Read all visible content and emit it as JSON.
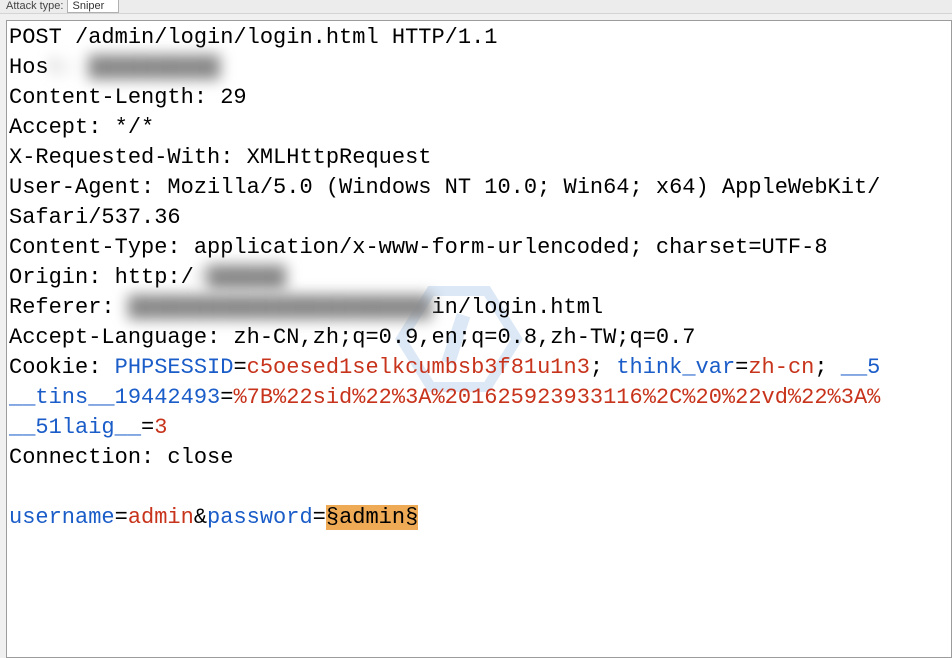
{
  "toolbar": {
    "label": "Attack type:",
    "selected": "Sniper"
  },
  "req": {
    "method_line": "POST /admin/login/login.html HTTP/1.1",
    "host_prefix": "Hos",
    "host_redacted": "t: ██████████",
    "content_length": "Content-Length: 29",
    "accept": "Accept: */*",
    "x_req_with": "X-Requested-With: XMLHttpRequest",
    "user_agent": "User-Agent: Mozilla/5.0 (Windows NT 10.0; Win64; x64) AppleWebKit/",
    "safari": "Safari/537.36",
    "content_type": "Content-Type: application/x-www-form-urlencoded; charset=UTF-8",
    "origin_prefix": "Origin: http:/",
    "origin_redacted": "/██████",
    "referer_prefix": "Referer:",
    "referer_redacted": " ███████████████████████",
    "referer_suffix": "in/login.html",
    "accept_lang": "Accept-Language: zh-CN,zh;q=0.9,en;q=0.8,zh-TW;q=0.7",
    "cookie_prefix": "Cookie: ",
    "c1_name": "PHPSESSID",
    "c1_val": "c5oesed1selkcumbsb3f81u1n3",
    "c1_sep": "; ",
    "c2_name": "think_var",
    "c2_val": "zh-cn",
    "c2_sep": "; ",
    "c3_name": "__5",
    "c4_name": "__tins__19442493",
    "c4_val": "%7B%22sid%22%3A%201625923933116%2C%20%22vd%22%3A%",
    "c5_name": "__51laig__",
    "c5_val": "3",
    "connection": "Connection: close",
    "body_p1": "username",
    "body_v1": "admin",
    "body_amp": "&",
    "body_p2": "password",
    "body_marker": "§admin§"
  },
  "watermark": "网E攻击"
}
